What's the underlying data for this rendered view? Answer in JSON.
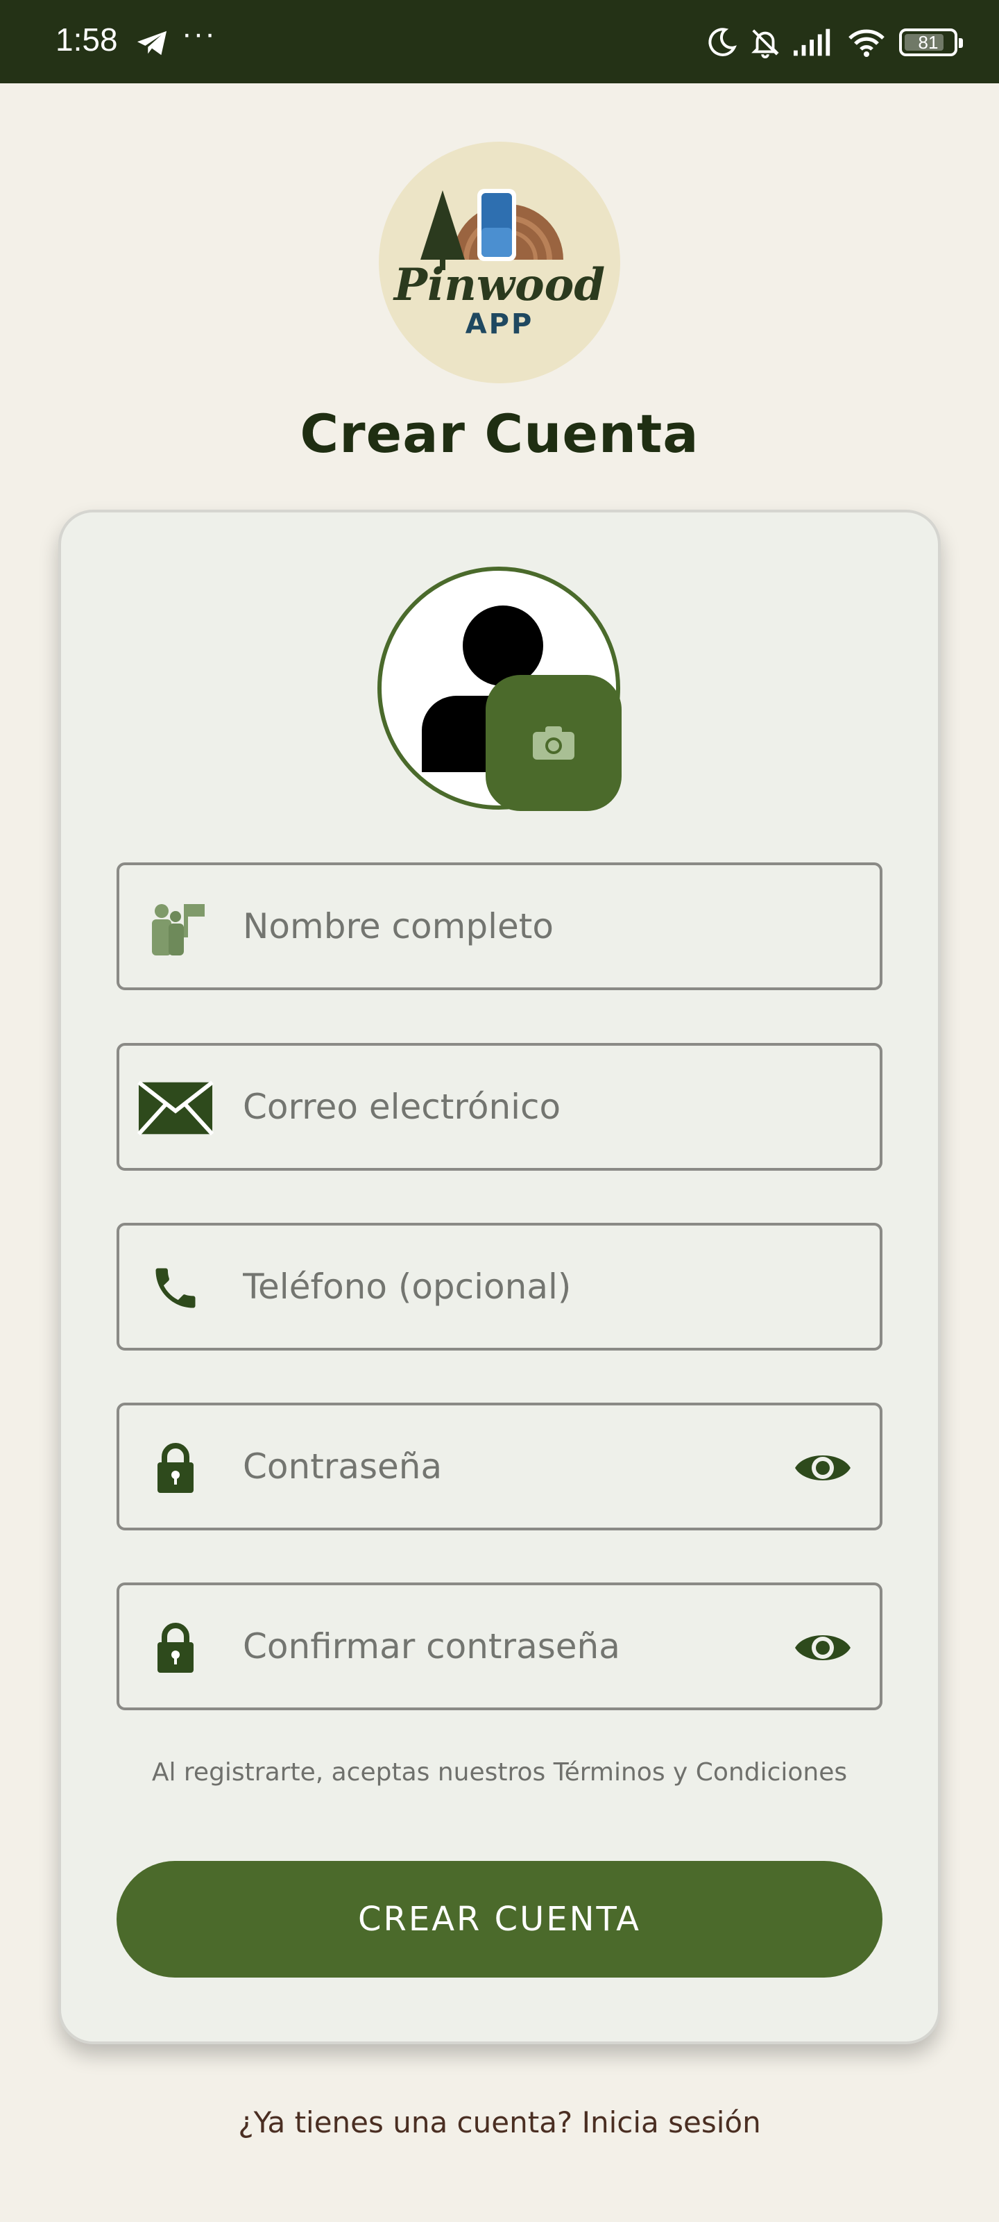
{
  "status_bar": {
    "time": "1:58",
    "more": "···",
    "battery": "81",
    "icons": [
      "telegram-icon",
      "moon-icon",
      "bell-off-icon",
      "signal-icon",
      "wifi-icon",
      "battery-icon"
    ]
  },
  "logo": {
    "word": "Pinwood",
    "sub": "APP"
  },
  "page": {
    "title": "Crear Cuenta"
  },
  "avatar": {
    "icons": [
      "person-icon",
      "camera-icon"
    ]
  },
  "form": {
    "name_placeholder": "Nombre completo",
    "email_placeholder": "Correo electrónico",
    "phone_placeholder": "Teléfono (opcional)",
    "password_placeholder": "Contraseña",
    "confirm_placeholder": "Confirmar contraseña",
    "icons": [
      "people-flag-icon",
      "envelope-icon",
      "phone-icon",
      "lock-icon",
      "eye-icon"
    ]
  },
  "terms": "Al registrarte, aceptas nuestros Términos y Condiciones",
  "create_button": "CREAR CUENTA",
  "login_link": "¿Ya tienes una cuenta? Inicia sesión",
  "colors": {
    "primary": "#4b6a2b",
    "status_bar": "#243216",
    "background": "#f3f0e8",
    "card": "#eef0ea"
  }
}
